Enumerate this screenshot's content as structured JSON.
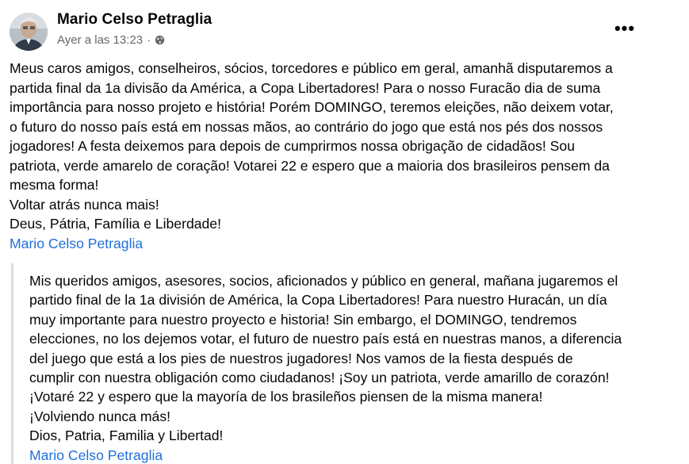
{
  "post": {
    "author": "Mario Celso Petraglia",
    "timestamp": "Ayer a las 13:23",
    "separator": "·",
    "privacy_icon": "globe-icon",
    "more_icon": "more-horizontal-icon",
    "more_glyph": "•••",
    "body_lines": [
      "Meus caros amigos, conselheiros, sócios, torcedores e público em geral, amanhã disputaremos a",
      "partida final da 1a divisão da América, a Copa Libertadores! Para o nosso Furacão dia de suma",
      "importância para nosso projeto e história! Porém DOMINGO, teremos eleições, não deixem votar,",
      "o futuro do nosso país está em nossas mãos, ao contrário do jogo que está nos pés dos nossos",
      "jogadores! A festa deixemos para depois de cumprirmos nossa obrigação de cidadãos! Sou",
      "patriota, verde amarelo de coração! Votarei 22 e espero que a maioria dos brasileiros pensem da",
      "mesma forma!",
      "Voltar atrás nunca mais!",
      "Deus, Pátria, Família e Liberdade!"
    ],
    "mention": "Mario Celso Petraglia"
  },
  "translation": {
    "lines": [
      "Mis queridos amigos, asesores, socios, aficionados y público en general, mañana jugaremos el",
      "partido final de la 1a división de América, la Copa Libertadores! Para nuestro Huracán, un día",
      "muy importante para nuestro proyecto e historia! Sin embargo, el DOMINGO, tendremos",
      "elecciones, no los dejemos votar, el futuro de nuestro país está en nuestras manos, a diferencia",
      "del juego que está a los pies de nuestros jugadores! Nos vamos de la fiesta después de",
      "cumplir con nuestra obligación como ciudadanos! ¡Soy un patriota, verde amarillo de corazón!",
      "¡Votaré 22 y espero que la mayoría de los brasileños piensen de la misma manera!",
      "¡Volviendo nunca más!",
      "Dios, Patria, Familia y Libertad!"
    ],
    "mention": "Mario Celso Petraglia"
  },
  "colors": {
    "text": "#050505",
    "meta": "#65676b",
    "link": "#216fdb",
    "quote_border": "#dadde1"
  }
}
